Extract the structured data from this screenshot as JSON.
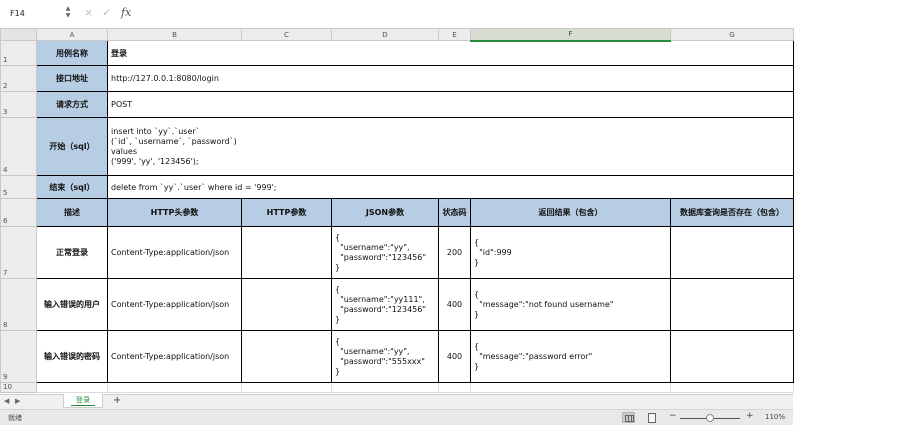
{
  "formula_bar": {
    "cell_ref": "F14",
    "cancel_icon": "×",
    "confirm_icon": "✓",
    "fx_label": "fx",
    "value": ""
  },
  "columns": [
    "A",
    "B",
    "C",
    "D",
    "E",
    "F",
    "G"
  ],
  "rows": [
    "1",
    "2",
    "3",
    "4",
    "5",
    "6",
    "7",
    "8",
    "9",
    "10"
  ],
  "info": {
    "case_name_label": "用例名称",
    "case_name": "登录",
    "url_label": "接口地址",
    "url": "http://127.0.0.1:8080/login",
    "method_label": "请求方式",
    "method": "POST",
    "setup_label": "开始（sql）",
    "setup_sql": "insert into `yy`.`user`\n(`id`, `username`, `password`)\nvalues\n('999', 'yy', '123456');",
    "teardown_label": "结束（sql）",
    "teardown_sql": "delete from `yy`.`user` where id = '999';"
  },
  "headers": {
    "desc": "描述",
    "http_headers": "HTTP头参数",
    "http_params": "HTTP参数",
    "json_params": "JSON参数",
    "status_code": "状态码",
    "result": "返回结果（包含）",
    "db_check": "数据库查询是否存在（包含）"
  },
  "cases": [
    {
      "desc": "正常登录",
      "http_headers": "Content-Type:application/json",
      "http_params": "",
      "json": "{\n  \"username\":\"yy\",\n  \"password\":\"123456\"\n}",
      "status": "200",
      "result": "{\n  \"id\":999\n}",
      "db_check": ""
    },
    {
      "desc": "输入错误的用户",
      "http_headers": "Content-Type:application/json",
      "http_params": "",
      "json": "{\n  \"username\":\"yy111\",\n  \"password\":\"123456\"\n}",
      "status": "400",
      "result": "{\n  \"message\":\"not found username\"\n}",
      "db_check": ""
    },
    {
      "desc": "输入错误的密码",
      "http_headers": "Content-Type:application/json",
      "http_params": "",
      "json": "{\n  \"username\":\"yy\",\n  \"password\":\"555xxx\"\n}",
      "status": "400",
      "result": "{\n  \"message\":\"password error\"\n}",
      "db_check": ""
    }
  ],
  "sheet_tabs": [
    "登录"
  ],
  "status_bar": {
    "status": "就绪",
    "zoom": "110%",
    "zoom_fraction": 0.5
  }
}
